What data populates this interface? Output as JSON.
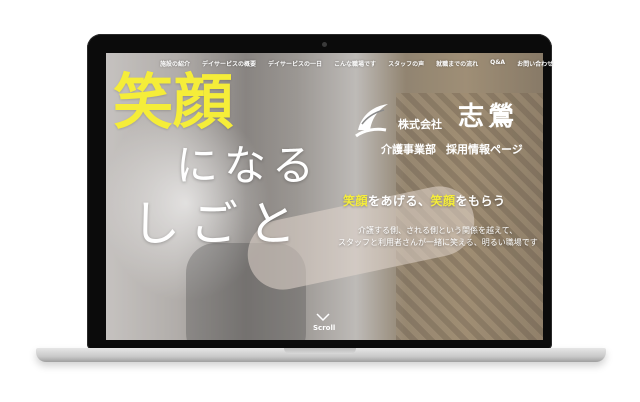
{
  "nav": {
    "items": [
      {
        "label": "施設の紹介"
      },
      {
        "label": "デイサービスの概要"
      },
      {
        "label": "デイサービスの一日"
      },
      {
        "label": "こんな職場です"
      },
      {
        "label": "スタッフの声"
      },
      {
        "label": "就職までの流れ"
      },
      {
        "label": "Q&A"
      },
      {
        "label": "お問い合わせ"
      }
    ]
  },
  "hero": {
    "line1": "笑顔",
    "line2": "になる",
    "line3": "しごと"
  },
  "company": {
    "kind": "株式会社",
    "name": "志鶯",
    "department": "介護事業部",
    "recruit": "採用情報ページ"
  },
  "tagline": {
    "part1": "笑顔",
    "part2": "をあげる、",
    "part3": "笑顔",
    "part4": "をもらう"
  },
  "description": {
    "line1": "介護する側、される側という関係を越えて、",
    "line2": "スタッフと利用者さんが一緒に笑える、明るい職場です"
  },
  "scroll": {
    "label": "Scroll"
  },
  "colors": {
    "accent_yellow": "#f5ed39",
    "text_white": "#ffffff",
    "frame_black": "#0b0b0b"
  }
}
